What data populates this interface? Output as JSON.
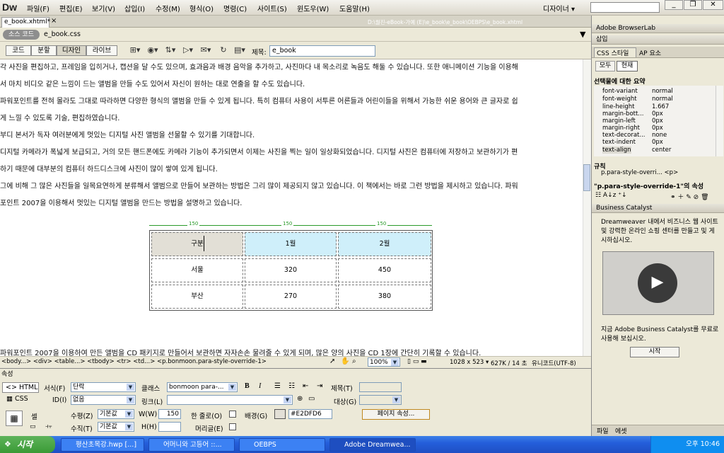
{
  "app": {
    "logo": "Dw",
    "designer": "디자이너 ▾",
    "window_controls": [
      "_",
      "❐",
      "✕"
    ]
  },
  "menu": [
    "파일(F)",
    "편집(E)",
    "보기(V)",
    "삽입(I)",
    "수정(M)",
    "형식(O)",
    "명령(C)",
    "사이트(S)",
    "윈도우(W)",
    "도움말(H)"
  ],
  "doc_tab": {
    "name": "e_book.xhtml*",
    "close": "×",
    "path": "D:\\월진-eBook-가예 (E)\\e_book\\e_book\\OEBPS\\e_book.xhtml"
  },
  "related": {
    "source_code": "소스 코드",
    "css_file": "e_book.css"
  },
  "views": [
    "코드",
    "분할",
    "디자인",
    "라이브"
  ],
  "title_label": "제목:",
  "title_value": "e_book",
  "paragraphs": [
    "각 사진을 편집하고, 프레임을 입히거나, 캡션을 달 수도 있으며, 효과음과 배경 음악을 추가하고, 사진마다 내 목소리로 녹음도 해둘 수 있습니다. 또한 애니메이션 기능을 이용해",
    "서 마치 비디오 같은 느낌이 드는 앨범을 만들 수도 있어서 자신이 원하는 대로 연출을 할 수도 있습니다.",
    "파워포인트를 전혀 몰라도 그대로 따라하면 다양한 형식의 앨범을 만들 수 있게 됩니다. 특히 컴퓨터 사용이 서투른 어른들과 어린이들을 위해서 가능한 쉬운 용어와 큰 글자로 쉽",
    "게 느낄 수 있도록 기술, 편집하였습니다.",
    "부디 본서가 독자 여러분에게 멋있는 디지털 사진 앨범을 선물할 수 있기를 기대합니다.",
    "디지털 카메라가 폭넓게 보급되고, 거의 모든 핸드폰에도 카메라 기능이 추가되면서 이제는 사진을 찍는 일이 일상화되었습니다. 디지털 사진은 컴퓨터에 저장하고 보관하기가 편",
    "하기 때문에 대부분의 컴퓨터 하드디스크에 사진이 많이 쌓여 있게 됩니다.",
    "그에 비해 그 많은 사진들을 일목요연하게 분류해서 앨범으로 만들어 보관하는 방법은 그리 많이 제공되지 않고 있습니다. 이 책에서는 바로 그런 방법을 제시하고 있습니다. 파워",
    "포인트 2007을 이용해서 멋있는 디지털 앨범을 만드는 방법을 설명하고 있습니다.",
    "파워포인트 2007을 이용하여 만든 앨범을 CD 패키지로 만들어서 보관하면 자자손손 물려줄 수 있게 되며, 많은 양의 사진을 CD 1장에 간단히 기록할 수 있습니다."
  ],
  "table": {
    "col_widths": [
      "150",
      "150",
      "150"
    ],
    "rows": [
      [
        "구분",
        "1월",
        "2월"
      ],
      [
        "서울",
        "320",
        "450"
      ],
      [
        "부산",
        "270",
        "380"
      ]
    ]
  },
  "statusbar": {
    "tags": "<body...> <div> <table...> <tbody> <tr> <td...> <p.bonmoon.para-style-override-1>",
    "zoom": "100%",
    "size": "1028 x 523 ▾",
    "file": "627K / 14 초",
    "encoding": "유니코드(UTF-8)"
  },
  "props": {
    "title": "속성",
    "html_tab": "HTML",
    "css_tab": "CSS",
    "format_label": "서식(F)",
    "format_value": "단락",
    "class_label": "클래스",
    "class_value": "bonmoon para-...",
    "title_label": "제목(T)",
    "id_label": "ID(I)",
    "id_value": "없음",
    "link_label": "링크(L)",
    "target_label": "대상(G)",
    "cell_label": "셀",
    "horz_label": "수평(Z)",
    "horz_value": "기본값",
    "vert_label": "수직(T)",
    "vert_value": "기본값",
    "w_label": "W(W)",
    "w_value": "150",
    "h_label": "H(H)",
    "nowrap_label": "한 줄로(O)",
    "header_label": "머리글(E)",
    "bg_label": "배경(G)",
    "bg_value": "#E2DFD6",
    "page_props": "페이지 속성..."
  },
  "right_panel": {
    "browserlab": "Adobe BrowserLab",
    "insert": "삽입",
    "css_tab": "CSS 스타일",
    "ap_tab": "AP 요소",
    "all_btn": "모두",
    "current_btn": "현재",
    "summary": "선택물에 대한 요약",
    "css_props": [
      [
        "font-variant",
        "normal"
      ],
      [
        "font-weight",
        "normal"
      ],
      [
        "line-height",
        "1.667"
      ],
      [
        "margin-bott...",
        "0px"
      ],
      [
        "margin-left",
        "0px"
      ],
      [
        "margin-right",
        "0px"
      ],
      [
        "text-decorat...",
        "none"
      ],
      [
        "text-indent",
        "0px"
      ],
      [
        "text-align",
        "center"
      ]
    ],
    "rules": "규칙",
    "rule_value": "p.para-style-overri...  <p>",
    "props_of": "\"p.para-style-override-1\"의 속성",
    "bc_head": "Business Catalyst",
    "bc_text": "Dreamweaver 내에서 비즈니스 웹 사이트 및 강력한 온라인 쇼핑 센터를 만들고 및 게시하십시오.",
    "bc_text2": "지금 Adobe Business Catalyst를 무료로 사용해 보십시오.",
    "start_btn": "시작",
    "footer_tabs": [
      "파일",
      "에셋"
    ]
  },
  "taskbar": {
    "start": "시작",
    "tasks": [
      "평산초목강.hwp [...]",
      "어머니와 고등어 ::...",
      "OEBPS",
      "Adobe Dreamwea..."
    ],
    "time": "오후 10:46"
  }
}
